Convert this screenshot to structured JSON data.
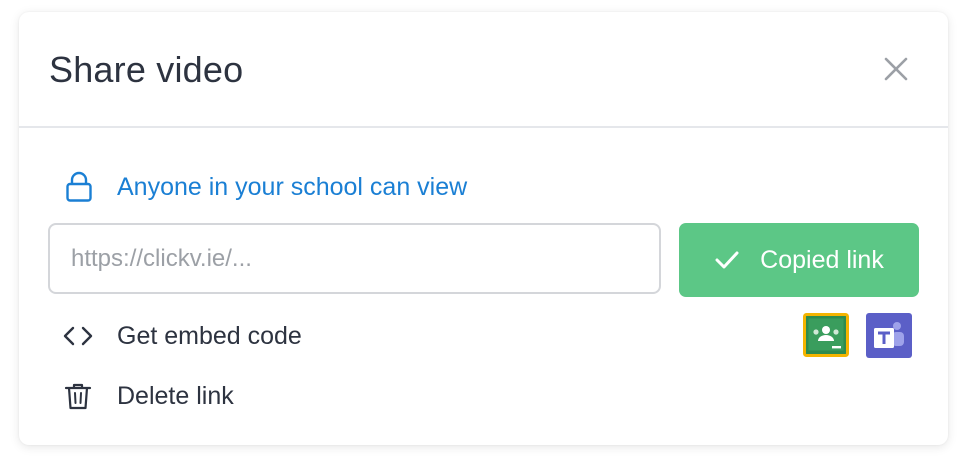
{
  "dialog": {
    "title": "Share video",
    "close_icon": "close-icon"
  },
  "privacy": {
    "icon": "lock-icon",
    "label": "Anyone in your school can view",
    "color": "#1a7fd4"
  },
  "link": {
    "placeholder": "https://clickv.ie/...",
    "value": ""
  },
  "copy_button": {
    "icon": "check-icon",
    "label": "Copied link",
    "color": "#5cc786"
  },
  "actions": [
    {
      "icon": "code-icon",
      "label": "Get embed code"
    },
    {
      "icon": "trash-icon",
      "label": "Delete link"
    }
  ],
  "share_targets": [
    {
      "icon": "google-classroom-icon",
      "color": "#2e8b4e",
      "border": "#f4b400"
    },
    {
      "icon": "microsoft-teams-icon",
      "color": "#5b5fc7"
    }
  ]
}
